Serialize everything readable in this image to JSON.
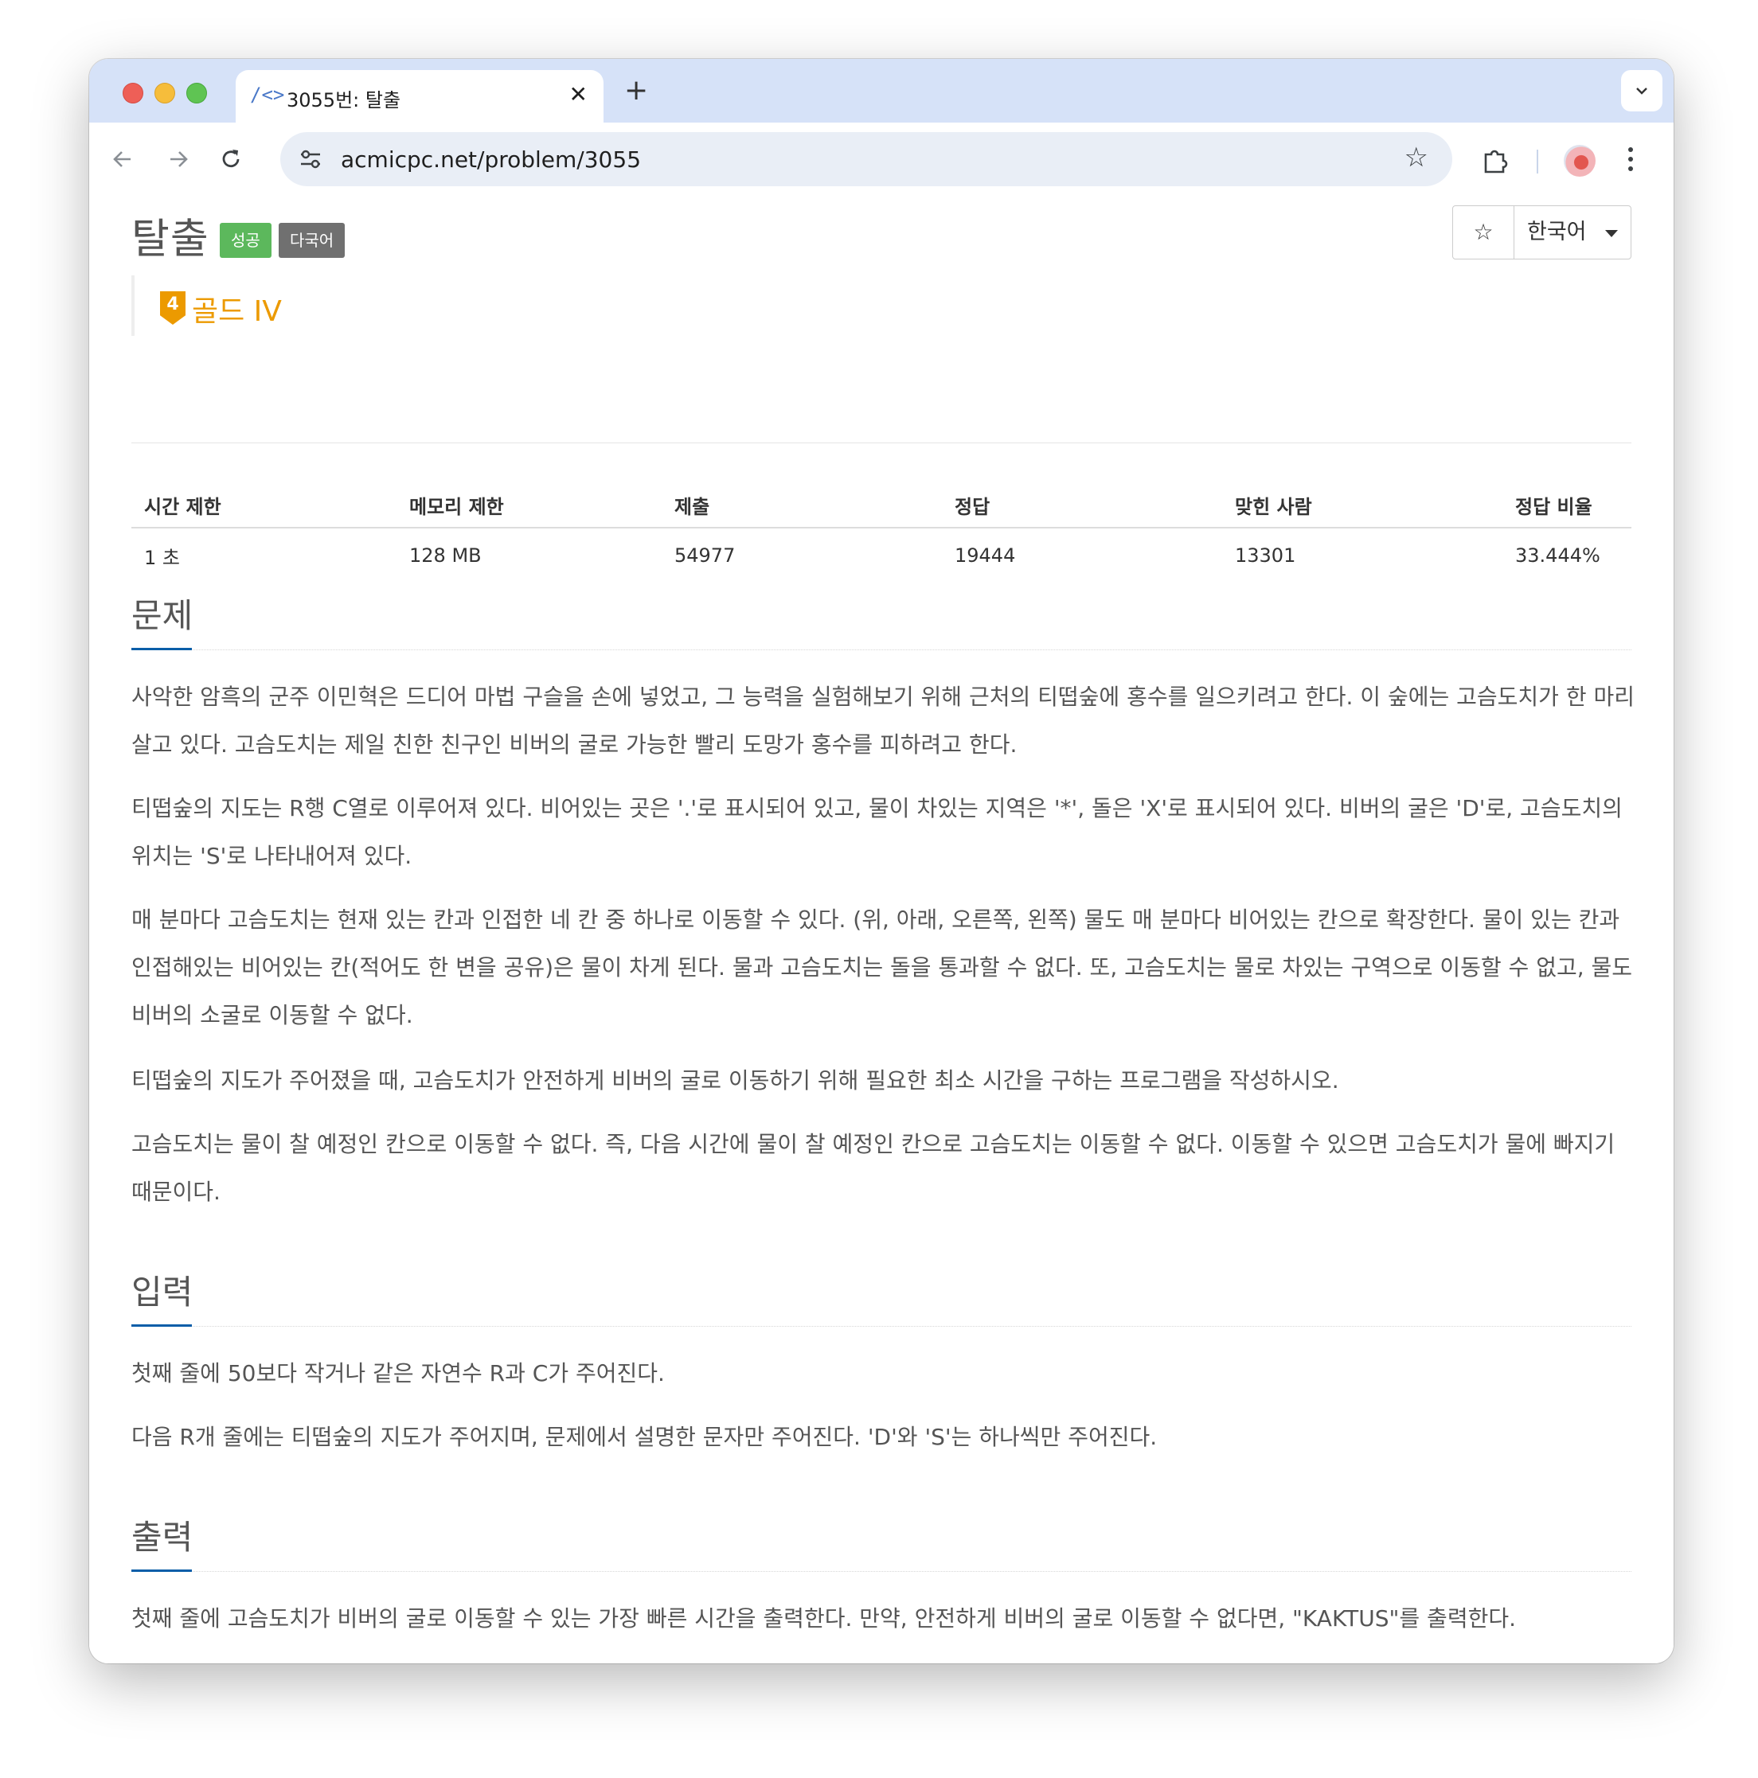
{
  "browser": {
    "tab_title": "3055번: 탈출",
    "tab_favicon": "/<>",
    "url": "acmicpc.net/problem/3055",
    "icons": [
      "back-icon",
      "forward-icon",
      "reload-icon",
      "site-info-icon",
      "star-icon",
      "extensions-icon",
      "profile-avatar",
      "more-menu-icon"
    ]
  },
  "problem": {
    "title": "탈출",
    "label_success": "성공",
    "label_multilang": "다국어",
    "language_button": "한국어",
    "tier_number": "4",
    "tier_name": "골드 IV",
    "tier_color": "#ec9a00"
  },
  "info_table": {
    "headers": [
      "시간 제한",
      "메모리 제한",
      "제출",
      "정답",
      "맞힌 사람",
      "정답 비율"
    ],
    "values": [
      "1 초",
      "128 MB",
      "54977",
      "19444",
      "13301",
      "33.444%"
    ]
  },
  "sections": {
    "problem_heading": "문제",
    "problem_paragraphs": [
      "사악한 암흑의 군주 이민혁은 드디어 마법 구슬을 손에 넣었고, 그 능력을 실험해보기 위해 근처의 티떱숲에 홍수를 일으키려고 한다. 이 숲에는 고슴도치가 한 마리 살고 있다. 고슴도치는 제일 친한 친구인 비버의 굴로 가능한 빨리 도망가 홍수를 피하려고 한다.",
      "티떱숲의 지도는 R행 C열로 이루어져 있다. 비어있는 곳은 '.'로 표시되어 있고, 물이 차있는 지역은 '*', 돌은 'X'로 표시되어 있다. 비버의 굴은 'D'로, 고슴도치의 위치는 'S'로 나타내어져 있다.",
      "매 분마다 고슴도치는 현재 있는 칸과 인접한 네 칸 중 하나로 이동할 수 있다. (위, 아래, 오른쪽, 왼쪽) 물도 매 분마다 비어있는 칸으로 확장한다. 물이 있는 칸과 인접해있는 비어있는 칸(적어도 한 변을 공유)은 물이 차게 된다. 물과 고슴도치는 돌을 통과할 수 없다. 또, 고슴도치는 물로 차있는 구역으로 이동할 수 없고, 물도 비버의 소굴로 이동할 수 없다.",
      "티떱숲의 지도가 주어졌을 때, 고슴도치가 안전하게 비버의 굴로 이동하기 위해 필요한 최소 시간을 구하는 프로그램을 작성하시오.",
      "고슴도치는 물이 찰 예정인 칸으로 이동할 수 없다. 즉, 다음 시간에 물이 찰 예정인 칸으로 고슴도치는 이동할 수 없다. 이동할 수 있으면 고슴도치가 물에 빠지기 때문이다."
    ],
    "input_heading": "입력",
    "input_paragraphs": [
      "첫째 줄에 50보다 작거나 같은 자연수 R과 C가 주어진다.",
      "다음 R개 줄에는 티떱숲의 지도가 주어지며, 문제에서 설명한 문자만 주어진다. 'D'와 'S'는 하나씩만 주어진다."
    ],
    "output_heading": "출력",
    "output_paragraphs": [
      "첫째 줄에 고슴도치가 비버의 굴로 이동할 수 있는 가장 빠른 시간을 출력한다. 만약, 안전하게 비버의 굴로 이동할 수 없다면, \"KAKTUS\"를 출력한다."
    ]
  }
}
